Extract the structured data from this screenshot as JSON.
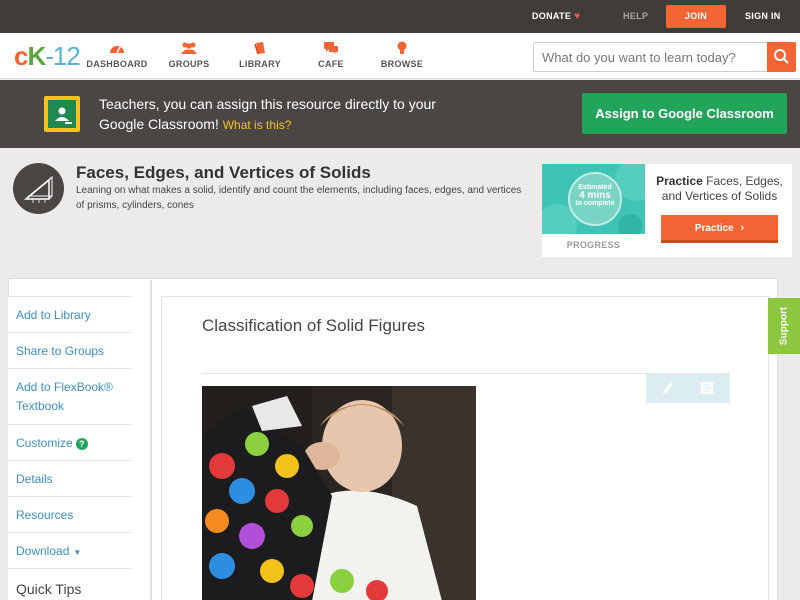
{
  "topbar": {
    "donate": "DONATE",
    "help": "HELP",
    "join": "JOIN",
    "sign_in": "SIGN IN"
  },
  "logo": {
    "part1": "c",
    "part2": "K",
    "part3": "-12"
  },
  "nav": {
    "items": [
      {
        "label": "DASHBOARD",
        "icon": "dashboard-icon"
      },
      {
        "label": "GROUPS",
        "icon": "groups-icon"
      },
      {
        "label": "LIBRARY",
        "icon": "library-icon"
      },
      {
        "label": "CAFE",
        "icon": "cafe-icon"
      },
      {
        "label": "BROWSE",
        "icon": "browse-icon"
      }
    ],
    "search_placeholder": "What do you want to learn today?"
  },
  "banner": {
    "text": "Teachers, you can assign this resource directly to your Google Classroom!",
    "what_link": "What is this?",
    "assign_button": "Assign to Google Classroom"
  },
  "concept": {
    "title": "Faces, Edges, and Vertices of Solids",
    "description": "Leaning on what makes a solid, identify and count the elements, including faces, edges, and vertices of prisms, cylinders, cones"
  },
  "practice": {
    "estimated": "Estimated",
    "minutes": "4 mins",
    "to_complete": "to complete",
    "progress_label": "PROGRESS",
    "prefix": "Practice",
    "title": "Faces, Edges, and Vertices of Solids",
    "button": "Practice"
  },
  "sidebar": {
    "add_to_library": "Add to Library",
    "share_to_groups": "Share to Groups",
    "add_to_flexbook": "Add to FlexBook® Textbook",
    "customize": "Customize",
    "details": "Details",
    "resources": "Resources",
    "download": "Download",
    "quick_tips": "Quick Tips"
  },
  "content": {
    "title": "Classification of Solid Figures"
  },
  "support": "Support",
  "colors": {
    "accent": "#f26433",
    "green": "#22a45a",
    "link": "#3b8fc4",
    "dark": "#3f3c39"
  }
}
